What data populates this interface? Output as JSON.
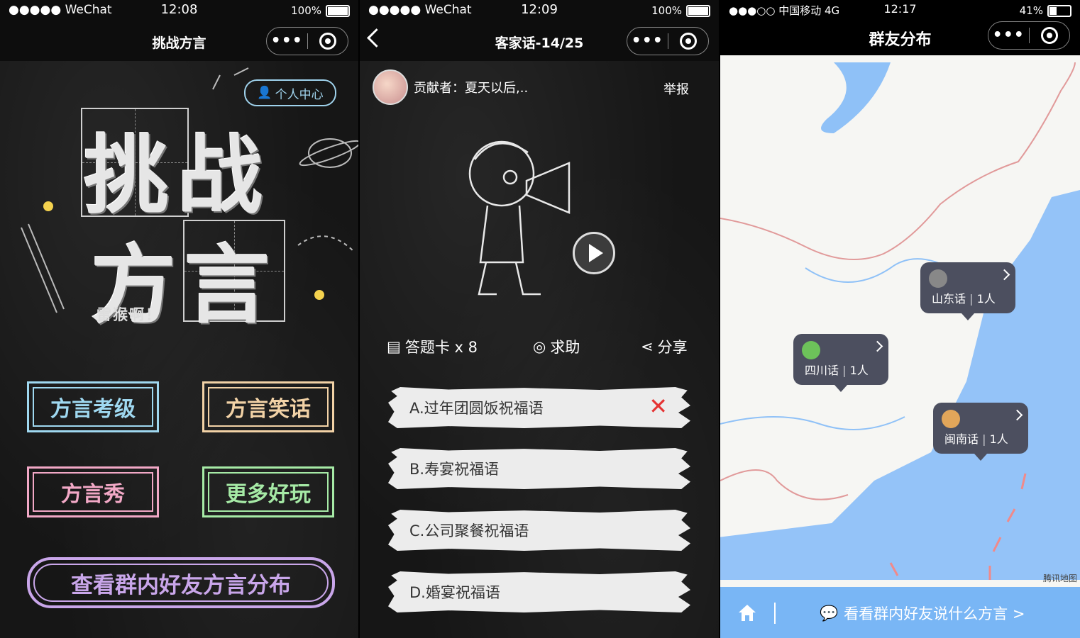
{
  "panel1": {
    "status": {
      "carrier": "●●●●● WeChat",
      "time": "12:08",
      "battery": "100%"
    },
    "nav_title": "挑战方言",
    "personal_center": "个人中心",
    "title_top": "挑战",
    "title_bottom": "方言",
    "subtitle": "雷猴啊！",
    "buttons": [
      {
        "label": "方言考级",
        "color": "#9fd8f0"
      },
      {
        "label": "方言笑话",
        "color": "#f2d2a6"
      },
      {
        "label": "方言秀",
        "color": "#f2a8c6"
      },
      {
        "label": "更多好玩",
        "color": "#a6eaa6"
      }
    ],
    "big_button": "查看群内好友方言分布"
  },
  "panel2": {
    "status": {
      "carrier": "●●●●● WeChat",
      "time": "12:09",
      "battery": "100%"
    },
    "nav_title": "客家话-14/25",
    "contributor": "贡献者：夏天以后,..",
    "report": "举报",
    "tools": {
      "answer_card": "答题卡 x 8",
      "help": "求助",
      "share": "分享"
    },
    "answers": [
      "A.过年团圆饭祝福语",
      "B.寿宴祝福语",
      "C.公司聚餐祝福语",
      "D.婚宴祝福语"
    ],
    "wrong_mark": "✕"
  },
  "panel3": {
    "status": {
      "carrier": "●●●○○ 中国移动  4G",
      "time": "12:17",
      "battery": "41%"
    },
    "nav_title": "群友分布",
    "bubbles": [
      {
        "dialect": "山东话",
        "count": "1人"
      },
      {
        "dialect": "四川话",
        "count": "1人"
      },
      {
        "dialect": "闽南话",
        "count": "1人"
      }
    ],
    "map_credit": "腾讯地图",
    "bottom_text": "看看群内好友说什么方言 >"
  }
}
